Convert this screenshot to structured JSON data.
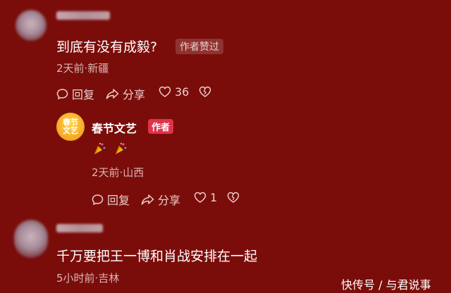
{
  "comment1": {
    "text": "到底有没有成毅?",
    "badge": "作者赞过",
    "meta": "2天前·新疆",
    "reply_label": "回复",
    "share_label": "分享",
    "like_count": "36"
  },
  "reply1": {
    "name": "春节文艺",
    "author_tag": "作者",
    "logo_text": "春节文艺",
    "emojis": "party-popper party-popper",
    "meta": "2天前·山西",
    "reply_label": "回复",
    "share_label": "分享",
    "like_count": "1"
  },
  "comment2": {
    "text": "千万要把王一博和肖战安排在一起",
    "meta": "5小时前·吉林"
  },
  "watermark": "快传号 / 与君说事",
  "colors": {
    "background": "#7a0d0a",
    "author_tag": "#e0324a"
  }
}
